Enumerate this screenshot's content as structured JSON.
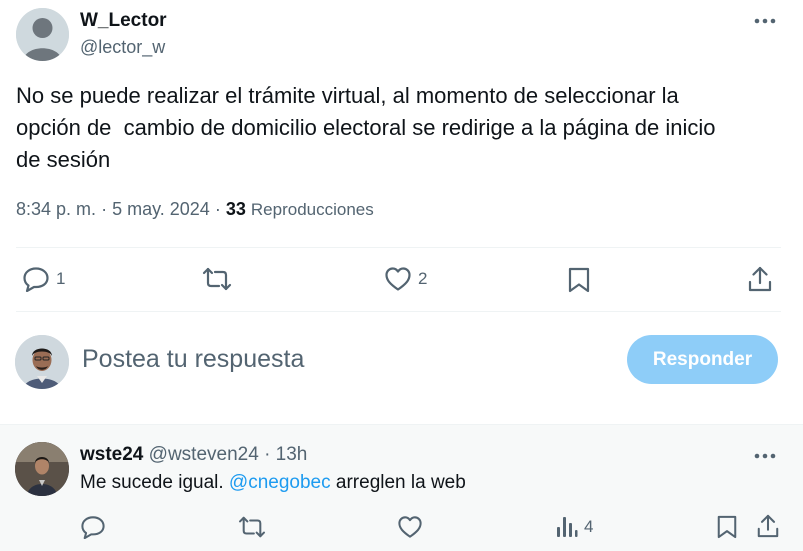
{
  "tweet": {
    "author_name": "W_Lector",
    "author_handle": "@lector_w",
    "text": "No se puede realizar el trámite virtual, al momento de seleccionar la\nopción de  cambio de domicilio electoral se redirige a la página de inicio\nde sesión",
    "time": "8:34 p. m.",
    "date": "5 may. 2024",
    "separator": "·",
    "views_count": "33",
    "views_label": "Reproducciones",
    "actions": {
      "reply_icon": "reply-icon",
      "reply_count": "1",
      "retweet_icon": "retweet-icon",
      "like_icon": "heart-icon",
      "like_count": "2",
      "bookmark_icon": "bookmark-icon",
      "share_icon": "share-icon"
    },
    "more_icon": "more-icon"
  },
  "composer": {
    "placeholder": "Postea tu respuesta",
    "button_label": "Responder",
    "button_color": "#8ecdf8"
  },
  "reply": {
    "author_name": "wste24",
    "author_handle": "@wsteven24",
    "separator": "·",
    "time": "13h",
    "text_before": "Me sucede igual. ",
    "mention": "@cnegobec",
    "text_after": " arreglen la web",
    "views_count": "4",
    "actions": [
      "reply-icon",
      "retweet-icon",
      "heart-icon",
      "analytics-icon",
      "bookmark-icon",
      "share-icon"
    ]
  },
  "colors": {
    "text": "#0f1419",
    "secondary": "#536471",
    "link": "#1d9bf0",
    "divider": "#eff3f4",
    "reply_bg": "#f7f9f9"
  }
}
